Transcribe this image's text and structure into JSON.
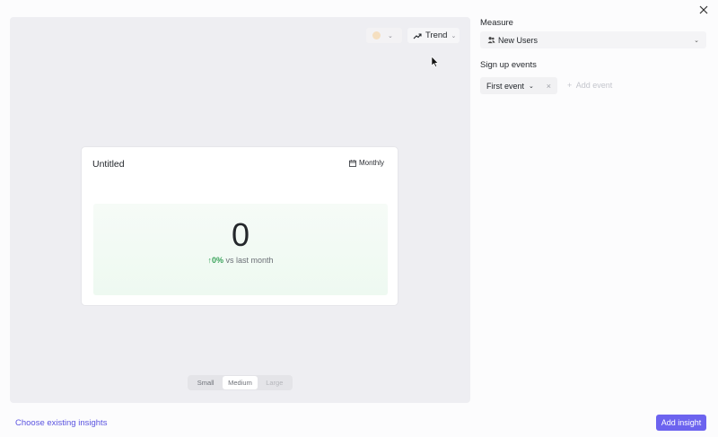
{
  "preview": {
    "trend_label": "Trend",
    "swatch_color": "#f5dfc0",
    "card": {
      "title": "Untitled",
      "period": "Monthly",
      "value": "0",
      "delta_pct": "0%",
      "delta_text": "vs last month"
    },
    "sizes": [
      {
        "label": "Small",
        "state": "normal"
      },
      {
        "label": "Medium",
        "state": "selected"
      },
      {
        "label": "Large",
        "state": "disabled"
      }
    ]
  },
  "panel": {
    "measure_label": "Measure",
    "measure_value": "New Users",
    "signup_label": "Sign up events",
    "event_chip": "First event",
    "add_event": "Add event"
  },
  "footer": {
    "choose_existing": "Choose existing insights",
    "add_insight": "Add insight"
  },
  "colors": {
    "accent": "#6c63ef",
    "link": "#5b54e0",
    "positive": "#3aa35b"
  }
}
